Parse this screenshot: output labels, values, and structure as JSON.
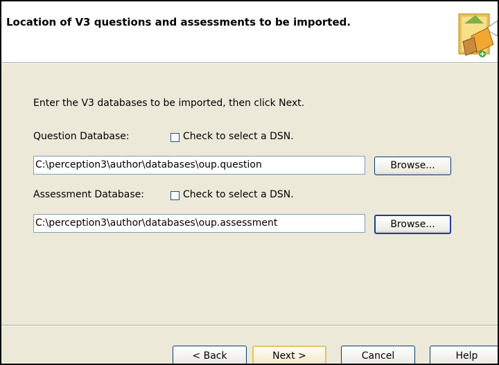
{
  "header": {
    "title": "Location of V3 questions and assessments to be imported.",
    "icon": "import-wizard-icon"
  },
  "main": {
    "instruction": "Enter the V3 databases to be imported, then click Next.",
    "question_db": {
      "label": "Question Database:",
      "dsn_checkbox_label": "Check to select a DSN.",
      "dsn_checked": false,
      "path": "C:\\perception3\\author\\databases\\oup.question",
      "browse_label": "Browse..."
    },
    "assessment_db": {
      "label": "Assessment Database:",
      "dsn_checkbox_label": "Check to select a DSN.",
      "dsn_checked": false,
      "path": "C:\\perception3\\author\\databases\\oup.assessment",
      "browse_label": "Browse..."
    }
  },
  "footer": {
    "back_label": "< Back",
    "next_label": "Next >",
    "cancel_label": "Cancel",
    "help_label": "Help"
  },
  "colors": {
    "dialog_bg": "#ECE9D8",
    "header_bg": "#FFFFFF",
    "button_border": "#003C74",
    "focus_border": "#E5C365"
  }
}
